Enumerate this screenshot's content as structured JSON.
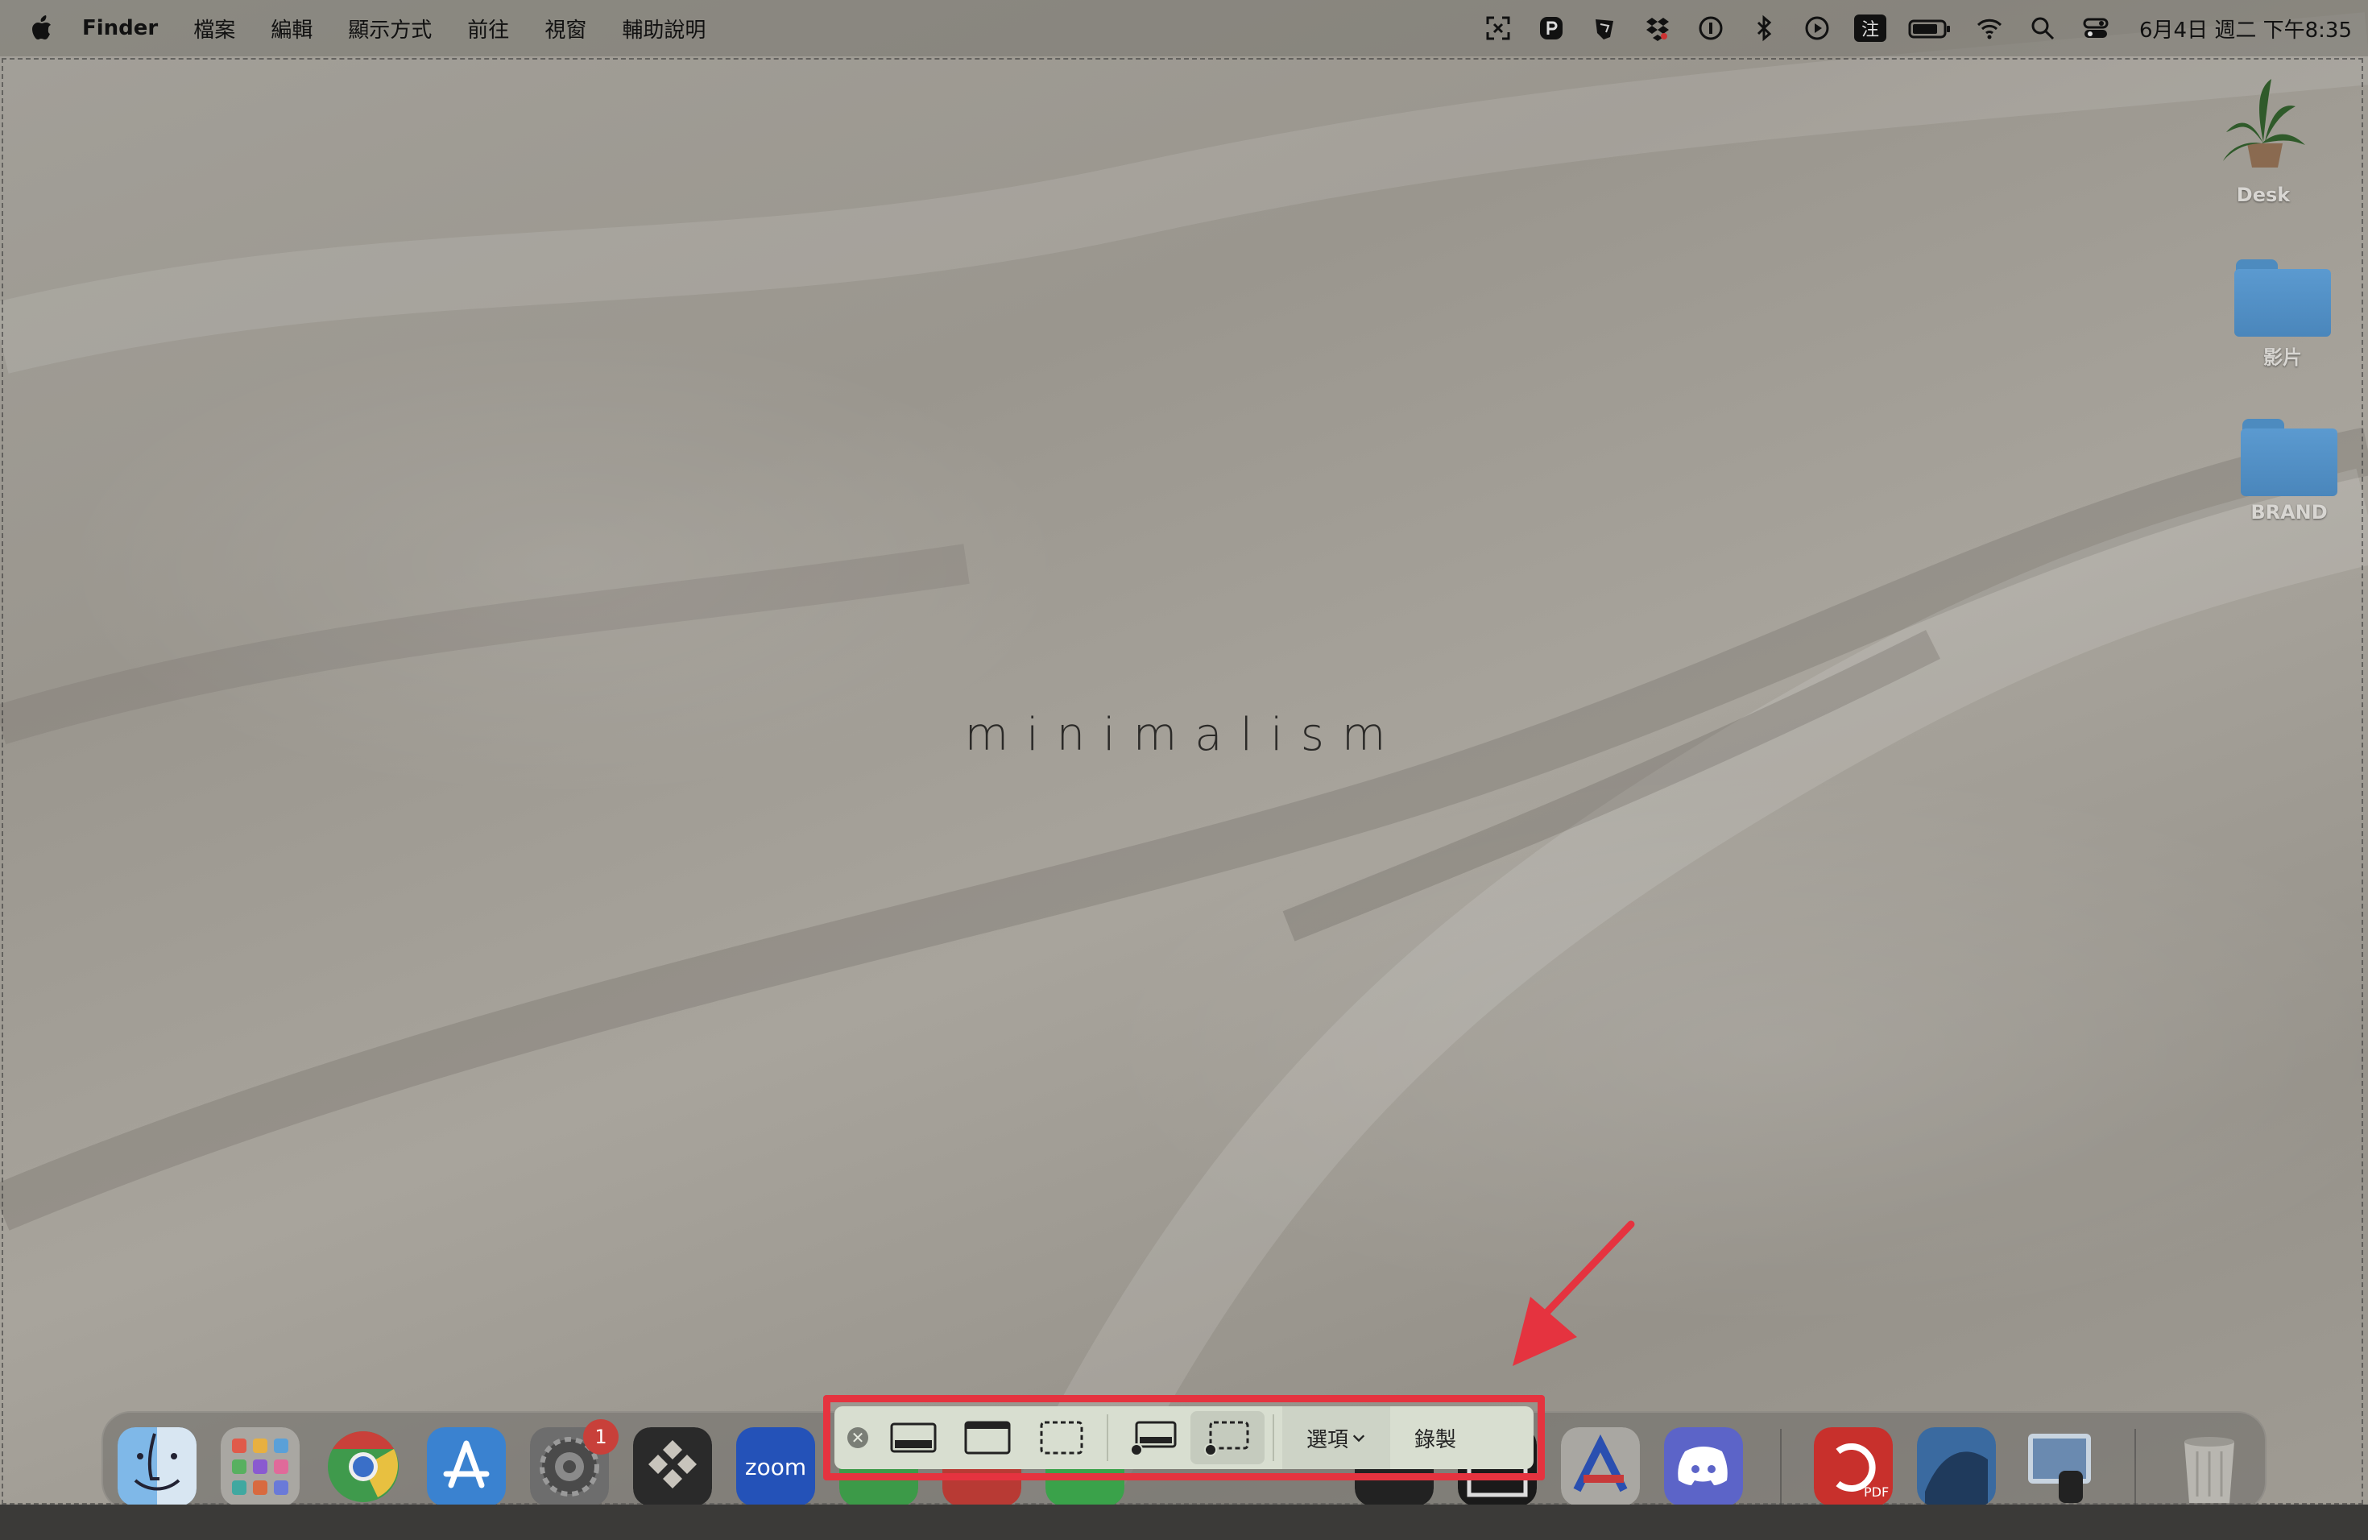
{
  "menubar": {
    "app_name": "Finder",
    "items": [
      "檔案",
      "編輯",
      "顯示方式",
      "前往",
      "視窗",
      "輔助說明"
    ],
    "input_method": "注",
    "clock": "6月4日 週二 下午8:35"
  },
  "wallpaper": {
    "text": "minimalism"
  },
  "desktop": {
    "icons": [
      {
        "label": "Desk"
      },
      {
        "label": "影片"
      },
      {
        "label": "BRAND"
      }
    ]
  },
  "dock": {
    "settings_badge": "1",
    "zoom_label": "zoom"
  },
  "capture_toolbar": {
    "options_label": "選項",
    "record_label": "錄製"
  },
  "colors": {
    "highlight": "#e5333f",
    "arrow": "#e5333f",
    "folder": "#5b9ad0",
    "toolbar_bg": "#d8ded0"
  }
}
